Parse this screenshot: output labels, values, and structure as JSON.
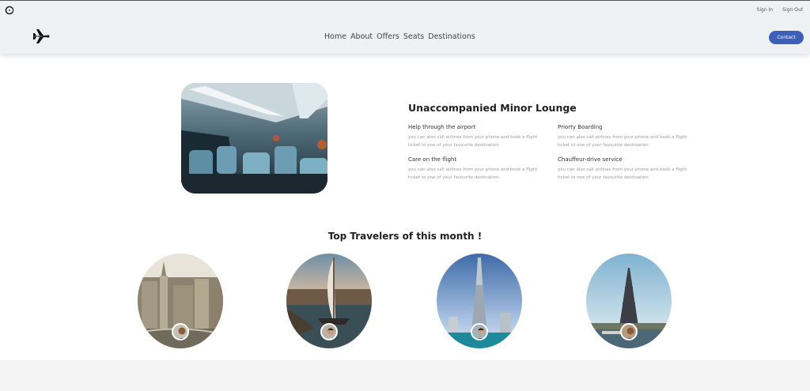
{
  "header": {
    "logo_icon": "circle-logo-icon",
    "brand_icon": "airplane-icon",
    "sign_in": "Sign In",
    "sign_out": "Sign Out",
    "nav": [
      "Home",
      "About",
      "Offers",
      "Seats",
      "Destinations"
    ],
    "contact": "Contact",
    "accent": "#3d5fb8"
  },
  "lounge": {
    "title": "Unaccompanied Minor Lounge",
    "features": [
      {
        "title": "Help through the airport",
        "desc_line1": "you can also call airlines from your phone and book a flight",
        "desc_line2": "ticket to one of your favourite destination"
      },
      {
        "title": "Priorty Boarding",
        "desc_line1": "you can also call airlines from your phone and book a flight",
        "desc_line2": "ticket to one of your favourite destination"
      },
      {
        "title": "Care on the flight",
        "desc_line1": "you can also call airlines from your phone and book a flight",
        "desc_line2": "ticket to one of your favourite destination"
      },
      {
        "title": "Chauffeur-drive service",
        "desc_line1": "you can also call airlines from your phone and book a flight",
        "desc_line2": "ticket to one of your favourite destination"
      }
    ]
  },
  "travelers": {
    "title": "Top Travelers of this month !"
  }
}
